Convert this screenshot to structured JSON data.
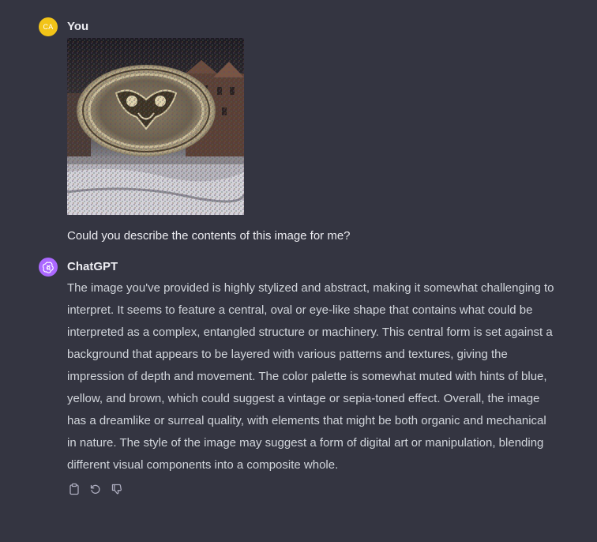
{
  "user_message": {
    "avatar_initials": "CA",
    "avatar_color": "#f2c418",
    "author": "You",
    "text": "Could you describe the contents of this image for me?"
  },
  "assistant_message": {
    "avatar_icon": "openai-logo-icon",
    "avatar_color": "#ab68ff",
    "author": "ChatGPT",
    "text": "The image you've provided is highly stylized and abstract, making it somewhat challenging to interpret. It seems to feature a central, oval or eye-like shape that contains what could be interpreted as a complex, entangled structure or machinery. This central form is set against a background that appears to be layered with various patterns and textures, giving the impression of depth and movement. The color palette is somewhat muted with hints of blue, yellow, and brown, which could suggest a vintage or sepia-toned effect. Overall, the image has a dreamlike or surreal quality, with elements that might be both organic and mechanical in nature. The style of the image may suggest a form of digital art or manipulation, blending different visual components into a composite whole.",
    "actions": [
      {
        "icon": "clipboard-icon"
      },
      {
        "icon": "regenerate-icon"
      },
      {
        "icon": "thumbs-down-icon"
      }
    ]
  },
  "colors": {
    "background": "#343541",
    "text_primary": "#ececf1",
    "text_secondary": "#d1d5db",
    "icon": "#acacbe"
  }
}
